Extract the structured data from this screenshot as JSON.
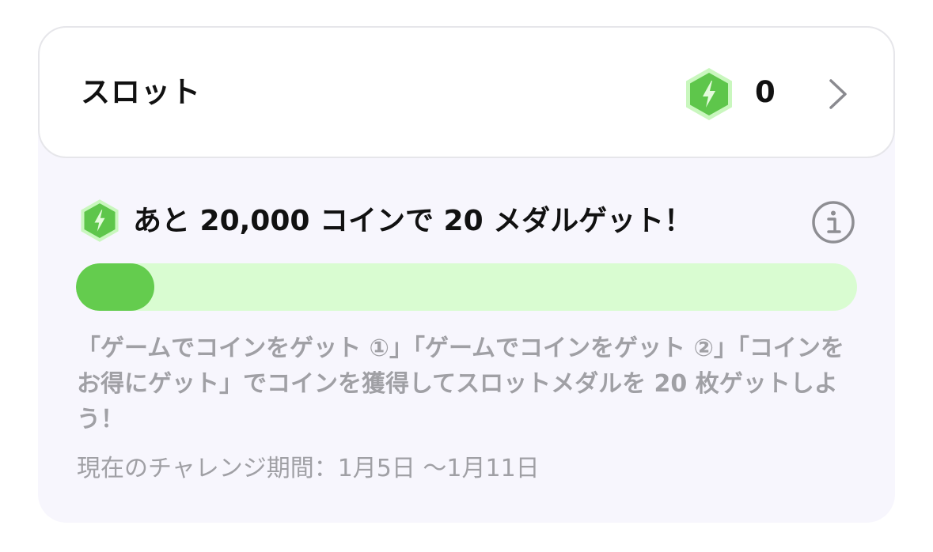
{
  "header": {
    "title": "スロット",
    "medal_count": "0",
    "medal_icon": "lightning-medal-icon",
    "chevron_icon": "chevron-right-icon"
  },
  "goal": {
    "text": "あと 20,000 コインで 20 メダルゲット！",
    "medal_icon": "lightning-medal-icon",
    "info_icon": "info-icon"
  },
  "progress": {
    "fraction": 0.1
  },
  "description": "「ゲームでコインをゲット ①」「ゲームでコインをゲット ②」「コインをお得にゲット」でコインを獲得してスロットメダルを 20 枚ゲットしよう！",
  "period": "現在のチャレンジ期間：1月5日 ～1月11日",
  "colors": {
    "accent_green": "#64cc4e",
    "track_green": "#d9fcd1",
    "card_background": "#f7f6fd",
    "muted_text": "#a0a0a5"
  }
}
